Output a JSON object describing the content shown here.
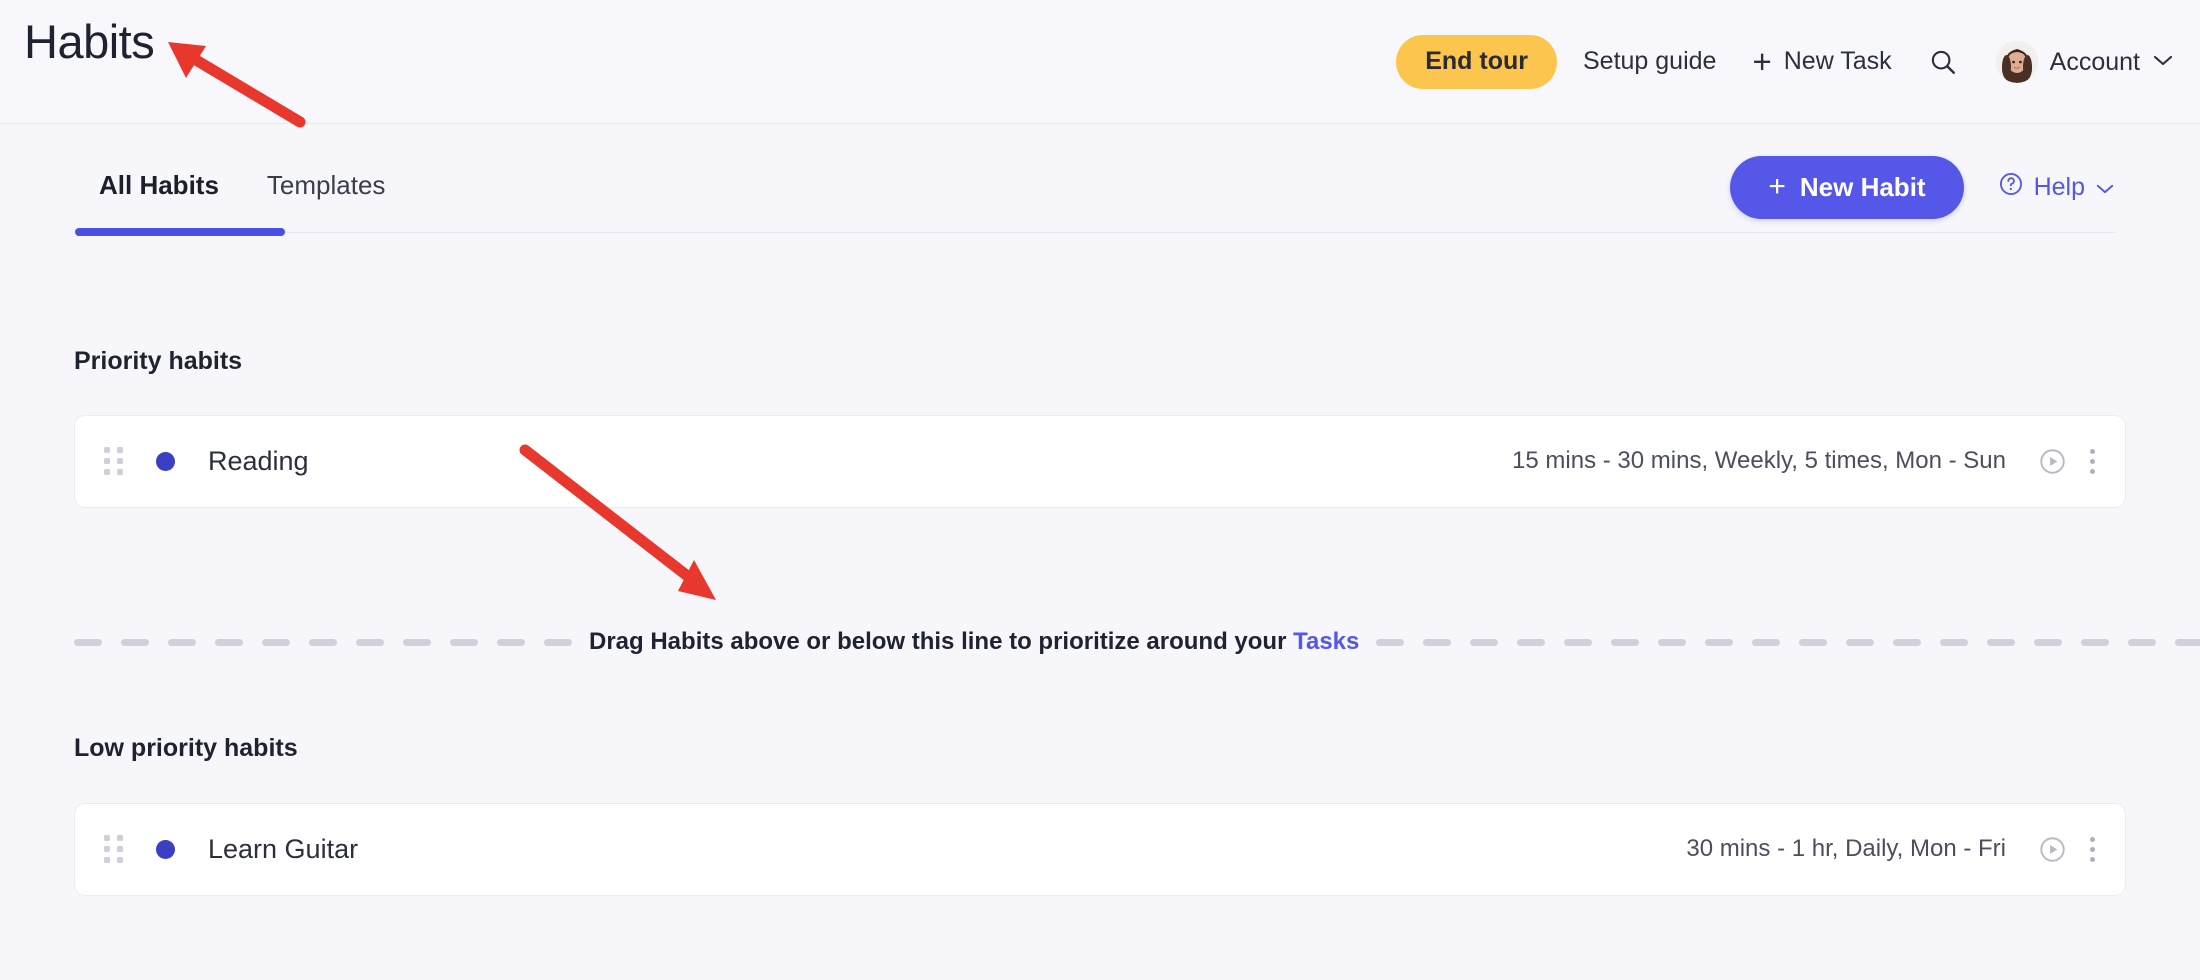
{
  "header": {
    "title": "Habits",
    "end_tour_label": "End tour",
    "setup_guide_label": "Setup guide",
    "new_task_label": "New Task",
    "new_task_plus": "+",
    "search_icon": "search-icon",
    "account_label": "Account",
    "account_chevron": "chevron-down-icon"
  },
  "tabs": {
    "items": [
      {
        "label": "All Habits",
        "active": true
      },
      {
        "label": "Templates",
        "active": false
      }
    ],
    "new_habit_label": "New Habit",
    "new_habit_plus": "+",
    "help_label": "Help",
    "help_icon": "question-circle-icon",
    "help_chevron": "chevron-down-icon"
  },
  "sections": [
    {
      "title": "Priority habits",
      "habits": [
        {
          "name": "Reading",
          "meta": "15 mins - 30 mins, Weekly, 5 times, Mon - Sun",
          "dot_color": "#3a3fc4",
          "drag_handle_icon": "drag-handle-icon",
          "play_icon": "play-circle-icon",
          "menu_icon": "kebab-menu-icon"
        }
      ]
    },
    {
      "title": "Low priority habits",
      "habits": [
        {
          "name": "Learn Guitar",
          "meta": "30 mins - 1 hr, Daily, Mon - Fri",
          "dot_color": "#3a3fc4",
          "drag_handle_icon": "drag-handle-icon",
          "play_icon": "play-circle-icon",
          "menu_icon": "kebab-menu-icon"
        }
      ]
    }
  ],
  "drag_divider": {
    "text_before": "Drag Habits above or below this line to prioritize around your",
    "link_label": "Tasks"
  },
  "colors": {
    "accent_blue": "#5457e8",
    "end_tour_yellow": "#fcc54d",
    "habit_dot": "#3a3fc4",
    "annotation_red": "#e8372c",
    "page_bg": "#f7f7fb",
    "card_bg": "#ffffff"
  },
  "annotations": [
    {
      "name": "arrow-to-title",
      "color": "#e8372c"
    },
    {
      "name": "arrow-to-drag-line",
      "color": "#e8372c"
    }
  ]
}
